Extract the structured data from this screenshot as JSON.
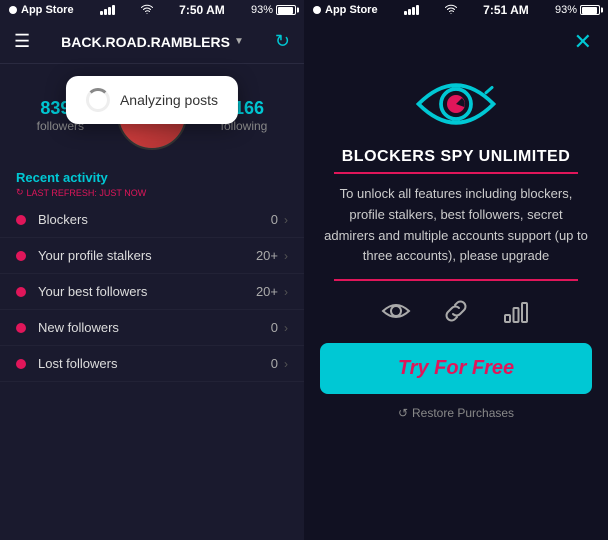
{
  "left": {
    "status_bar": {
      "app_store": "App Store",
      "time": "7:50 AM",
      "battery": "93%"
    },
    "nav": {
      "brand": "BACK.ROAD.RAMBLERS"
    },
    "profile": {
      "followers_count": "8398",
      "followers_label": "followers",
      "following_count": "6166",
      "following_label": "following"
    },
    "analyzing": {
      "text": "Analyzing posts"
    },
    "section": {
      "title": "Recent activity",
      "refresh_label": "LAST REFRESH: JUST NOW"
    },
    "activity_items": [
      {
        "name": "Blockers",
        "count": "0"
      },
      {
        "name": "Your profile stalkers",
        "count": "20+"
      },
      {
        "name": "Your best followers",
        "count": "20+"
      },
      {
        "name": "New followers",
        "count": "0"
      },
      {
        "name": "Lost followers",
        "count": "0"
      }
    ]
  },
  "right": {
    "status_bar": {
      "app_store": "App Store",
      "time": "7:51 AM",
      "battery": "93%"
    },
    "promo": {
      "title": "BLOCKERS SPY UNLIMITED",
      "description": "To unlock all features including blockers, profile stalkers, best followers, secret admirers and multiple accounts support (up to three accounts), please upgrade",
      "try_button": "Try For Free",
      "restore": "Restore Purchases"
    },
    "icons": {
      "eye": "eye-icon",
      "link": "link-icon",
      "chart": "chart-icon"
    }
  }
}
